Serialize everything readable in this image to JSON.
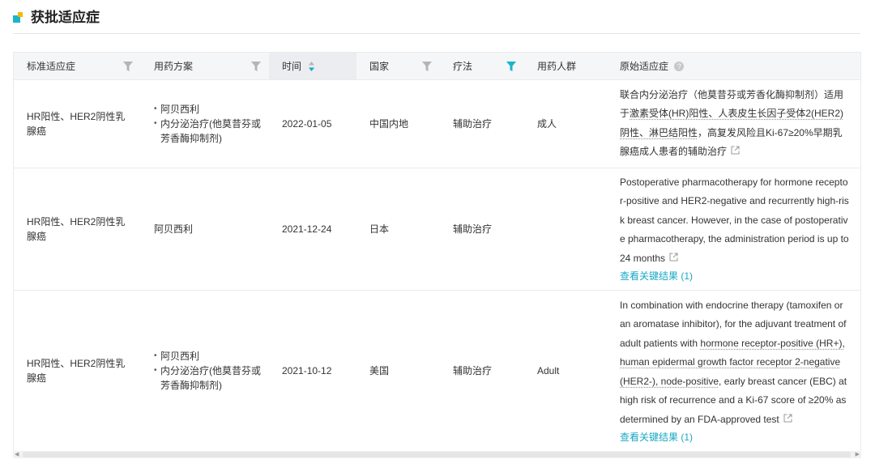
{
  "section": {
    "title": "获批适应症"
  },
  "columns": {
    "standard": "标准适应症",
    "regimen": "用药方案",
    "time": "时间",
    "country": "国家",
    "therapy": "疗法",
    "population": "用药人群",
    "original": "原始适应症"
  },
  "key_link_label": "查看关键结果 (1)",
  "rows": [
    {
      "standard": "HR阳性、HER2阴性乳腺癌",
      "regimen": [
        "阿贝西利",
        "内分泌治疗(他莫昔芬或芳香酶抑制剂)"
      ],
      "time": "2022-01-05",
      "country": "中国内地",
      "therapy": "辅助治疗",
      "population": "成人",
      "original_parts": [
        "联合内分泌治疗（他莫昔芬或芳香化酶抑制剂）适用于",
        "激素受体(HR)阳性、人表皮生长因子受体2(HER2)阴性、淋巴结阳性",
        "，高复发风险且Ki-67≥20%早期乳腺癌成人患者的辅助治疗"
      ]
    },
    {
      "standard": "HR阳性、HER2阴性乳腺癌",
      "regimen": [
        "阿贝西利"
      ],
      "time": "2021-12-24",
      "country": "日本",
      "therapy": "辅助治疗",
      "population": "",
      "original": "Postoperative pharmacotherapy for hormone receptor-positive and HER2-negative and recurrently high-risk breast cancer. However, in the case of postoperative pharmacotherapy, the administration period is up to 24 months"
    },
    {
      "standard": "HR阳性、HER2阴性乳腺癌",
      "regimen": [
        "阿贝西利",
        "内分泌治疗(他莫昔芬或芳香酶抑制剂)"
      ],
      "time": "2021-10-12",
      "country": "美国",
      "therapy": "辅助治疗",
      "population": "Adult",
      "original_parts": [
        "In combination with endocrine therapy (tamoxifen or an aromatase inhibitor), for the adjuvant treatment of adult patients with ",
        "hormone receptor-positive (HR+), human epidermal growth factor receptor 2-negative (HER2-), node-positive",
        ", early breast cancer (EBC) at high risk of recurrence and a Ki-67 score of ≥20% as determined by an FDA-approved test"
      ]
    }
  ]
}
